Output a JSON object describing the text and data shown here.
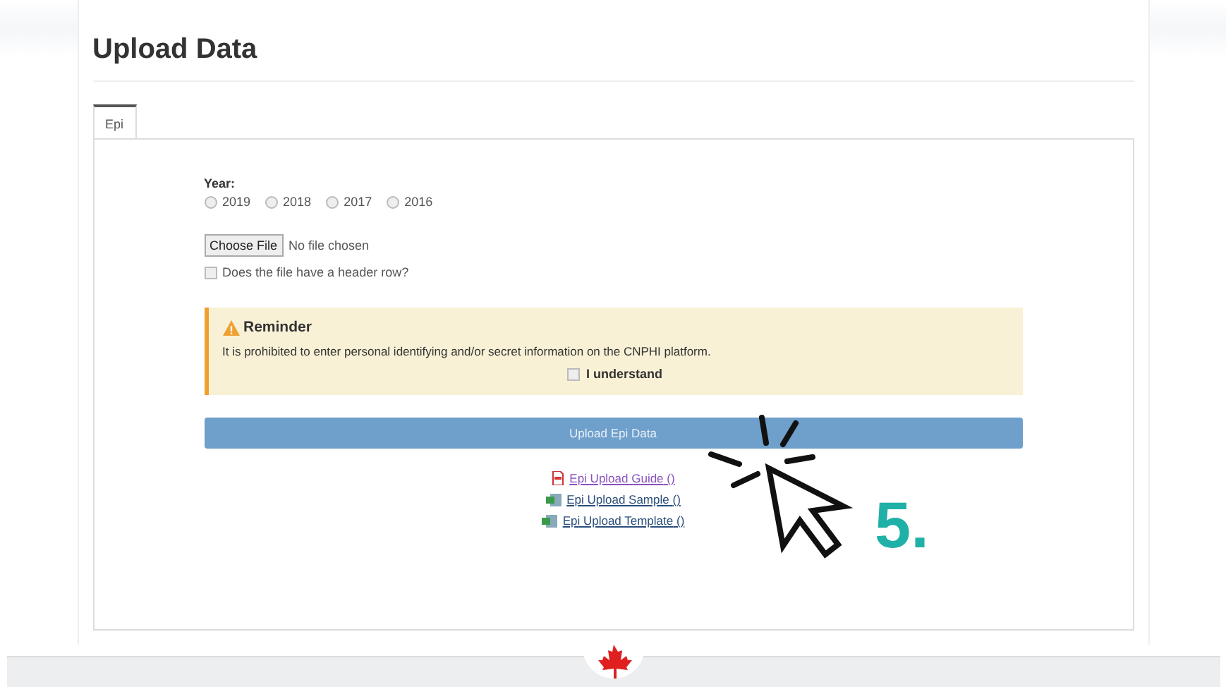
{
  "page": {
    "title": "Upload Data"
  },
  "tabs": [
    {
      "label": "Epi",
      "selected": true
    }
  ],
  "year": {
    "label": "Year:",
    "options": [
      {
        "label": "2019",
        "selected": false
      },
      {
        "label": "2018",
        "selected": false
      },
      {
        "label": "2017",
        "selected": false
      },
      {
        "label": "2016",
        "selected": false
      }
    ]
  },
  "file": {
    "button": "Choose File",
    "status": "No file chosen"
  },
  "header_row": {
    "label": "Does the file have a header row?",
    "checked": false
  },
  "reminder": {
    "title": "Reminder",
    "text": "It is prohibited to enter personal identifying and/or secret information on the CNPHI platform.",
    "confirm": {
      "label": "I understand",
      "checked": false
    }
  },
  "upload_button": "Upload Epi Data",
  "links": [
    {
      "kind": "pdf",
      "label": "Epi Upload Guide",
      "suffix": "()",
      "visited": true
    },
    {
      "kind": "sheet",
      "label": "Epi Upload Sample",
      "suffix": "()",
      "visited": false
    },
    {
      "kind": "sheet",
      "label": "Epi Upload Template",
      "suffix": "()",
      "visited": false
    }
  ],
  "callout": {
    "step": "5."
  }
}
